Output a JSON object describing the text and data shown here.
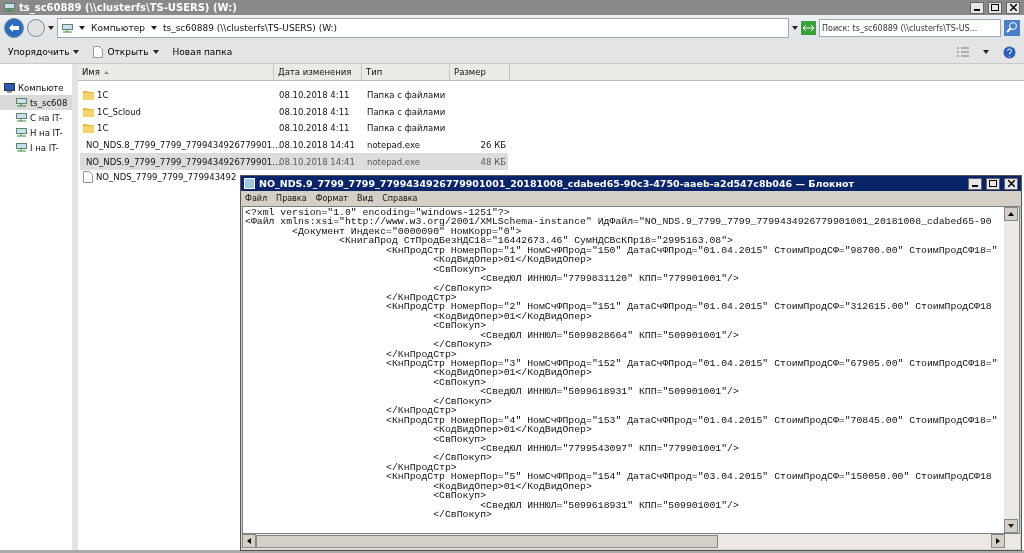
{
  "explorer": {
    "title": "ts_sc60889 (\\\\clusterfs\\TS-USERS) (W:)",
    "breadcrumbs": [
      "Компьютер",
      "ts_sc60889 (\\\\clusterfs\\TS-USERS) (W:)"
    ],
    "search": {
      "placeholder": "Поиск: ts_sc60889 (\\\\clusterfs\\TS-US..."
    },
    "toolbar": [
      {
        "label": "Упорядочить",
        "dropdown": true
      },
      {
        "label": "Открыть",
        "dropdown": true
      },
      {
        "label": "Новая папка",
        "dropdown": false
      }
    ],
    "sidebar": {
      "items": [
        {
          "label": "Компьюте",
          "kind": "computer",
          "selected": false,
          "children": [
            {
              "label": "ts_sc608",
              "kind": "drive",
              "selected": true
            },
            {
              "label": "C на IT-",
              "kind": "drive",
              "selected": false
            },
            {
              "label": "H на IT-",
              "kind": "drive",
              "selected": false
            },
            {
              "label": "I на IT-",
              "kind": "drive",
              "selected": false
            }
          ]
        }
      ]
    },
    "table": {
      "columns": [
        "Имя",
        "Дата изменения",
        "Тип",
        "Размер"
      ],
      "rows": [
        {
          "kind": "folder",
          "name": "1C",
          "date": "08.10.2018 4:11",
          "type": "Папка с файлами",
          "size": "",
          "selected": false
        },
        {
          "kind": "folder",
          "name": "1C_Scloud",
          "date": "08.10.2018 4:11",
          "type": "Папка с файлами",
          "size": "",
          "selected": false
        },
        {
          "kind": "folder",
          "name": "1C",
          "date": "08.10.2018 4:11",
          "type": "Папка с файлами",
          "size": "",
          "selected": false
        },
        {
          "kind": "file",
          "name": "NO_NDS.8_7799_7799_7799434926779901...",
          "date": "08.10.2018 14:41",
          "type": "notepad.exe",
          "size": "26 КБ",
          "selected": false
        },
        {
          "kind": "file",
          "name": "NO_NDS.9_7799_7799_7799434926779901...",
          "date": "08.10.2018 14:41",
          "type": "notepad.exe",
          "size": "48 КБ",
          "selected": true
        },
        {
          "kind": "file",
          "name": "NO_NDS_7799_7799_779943492",
          "date": "",
          "type": "",
          "size": "",
          "selected": false
        }
      ]
    }
  },
  "notepad": {
    "title": "NO_NDS.9_7799_7799_7799434926779901001_20181008_cdabed65-90c3-4750-aaeb-a2d547c8b046 — Блокнот",
    "menu": [
      "Файл",
      "Правка",
      "Формат",
      "Вид",
      "Справка"
    ],
    "lines": [
      "<?xml version=\"1.0\" encoding=\"windows-1251\"?>",
      "<Файл xmlns:xsi=\"http://www.w3.org/2001/XMLSchema-instance\" ИдФайл=\"NO_NDS.9_7799_7799_7799434926779901001_20181008_cdabed65-90",
      "\t<Документ Индекс=\"0000090\" НомКорр=\"0\">",
      "\t\t<КнигаПрод СтПродБезНДС18=\"16442673.46\" СумНДСВсКПр18=\"2995163.08\">",
      "\t\t\t<КнПродСтр НомерПор=\"1\" НомСчФПрод=\"150\" ДатаСчФПрод=\"01.04.2015\" СтоимПродСФ=\"98700.00\" СтоимПродСФ18=\"",
      "\t\t\t\t<КодВидОпер>01</КодВидОпер>",
      "\t\t\t\t<СвПокуп>",
      "\t\t\t\t\t<СведЮЛ ИННЮЛ=\"7799831120\" КПП=\"779901001\"/>",
      "\t\t\t\t</СвПокуп>",
      "\t\t\t</КнПродСтр>",
      "\t\t\t<КнПродСтр НомерПор=\"2\" НомСчФПрод=\"151\" ДатаСчФПрод=\"01.04.2015\" СтоимПродСФ=\"312615.00\" СтоимПродСФ18",
      "\t\t\t\t<КодВидОпер>01</КодВидОпер>",
      "\t\t\t\t<СвПокуп>",
      "\t\t\t\t\t<СведЮЛ ИННЮЛ=\"5099828664\" КПП=\"509901001\"/>",
      "\t\t\t\t</СвПокуп>",
      "\t\t\t</КнПродСтр>",
      "\t\t\t<КнПродСтр НомерПор=\"3\" НомСчФПрод=\"152\" ДатаСчФПрод=\"01.04.2015\" СтоимПродСФ=\"67905.00\" СтоимПродСФ18=\"",
      "\t\t\t\t<КодВидОпер>01</КодВидОпер>",
      "\t\t\t\t<СвПокуп>",
      "\t\t\t\t\t<СведЮЛ ИННЮЛ=\"5099618931\" КПП=\"509901001\"/>",
      "\t\t\t\t</СвПокуп>",
      "\t\t\t</КнПродСтр>",
      "\t\t\t<КнПродСтр НомерПор=\"4\" НомСчФПрод=\"153\" ДатаСчФПрод=\"01.04.2015\" СтоимПродСФ=\"70845.00\" СтоимПродСФ18=\"",
      "\t\t\t\t<КодВидОпер>01</КодВидОпер>",
      "\t\t\t\t<СвПокуп>",
      "\t\t\t\t\t<СведЮЛ ИННЮЛ=\"7799543097\" КПП=\"779901001\"/>",
      "\t\t\t\t</СвПокуп>",
      "\t\t\t</КнПродСтр>",
      "\t\t\t<КнПродСтр НомерПор=\"5\" НомСчФПрод=\"154\" ДатаСчФПрод=\"03.04.2015\" СтоимПродСФ=\"150050.00\" СтоимПродСФ18",
      "\t\t\t\t<КодВидОпер>01</КодВидОпер>",
      "\t\t\t\t<СвПокуп>",
      "\t\t\t\t\t<СведЮЛ ИННЮЛ=\"5099618931\" КПП=\"509901001\"/>",
      "\t\t\t\t</СвПокуп>"
    ]
  }
}
